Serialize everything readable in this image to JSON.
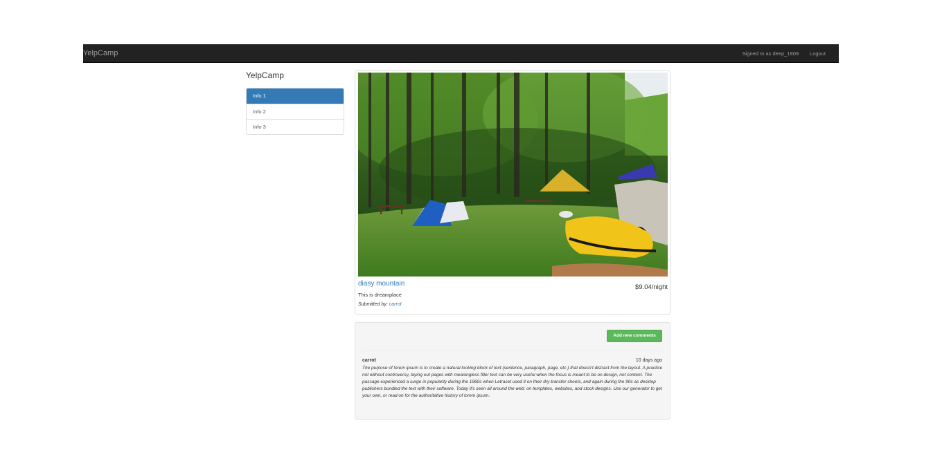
{
  "navbar": {
    "brand": "YelpCamp",
    "signed_in": "Signed In as deep_1809",
    "logout": "Logout"
  },
  "sidebar": {
    "title": "YelpCamp",
    "items": [
      {
        "label": "Info 1",
        "active": true
      },
      {
        "label": "Info 2",
        "active": false
      },
      {
        "label": "Info 3",
        "active": false
      }
    ]
  },
  "campground": {
    "name": "diasy mountain",
    "price": "$9.04/night",
    "description": "This is dreamplace",
    "submitted_by_label": "Submitted by:",
    "author": "carrot"
  },
  "comments": {
    "add_button": "Add new comments",
    "items": [
      {
        "author": "carrot",
        "date": "10 days ago",
        "text": "The purpose of lorem ipsum is to create a natural looking block of text (sentence, paragraph, page, etc.) that doesn't distract from the layout. A practice not without controversy, laying out pages with meaningless filler text can be very useful when the focus is meant to be on design, not content. The passage experienced a surge in popularity during the 1960s when Letraset used it on their dry-transfer sheets, and again during the 90s as desktop publishers bundled the text with their software. Today it's seen all around the web; on templates, websites, and stock designs. Use our generator to get your own, or read on for the authoritative history of lorem ipsum."
      }
    ]
  },
  "colors": {
    "navbar_bg": "#222222",
    "link": "#337ab7",
    "active_item": "#337ab7",
    "success_button": "#5cb85c"
  }
}
